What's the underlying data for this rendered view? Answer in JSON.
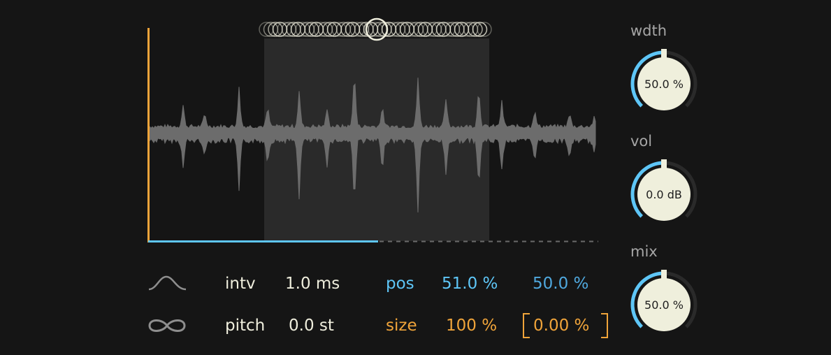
{
  "waveform": {
    "colors": {
      "background": "#151515",
      "selection": "#2a2a2a",
      "wave": "#6c6c6c",
      "envelope": "#f0a43a",
      "position": "#5ec6f7",
      "dashes": "#6a6a6a",
      "grain": "#efeedd"
    },
    "position_fraction": 0.51,
    "selection_fraction": [
      0.26,
      0.76
    ]
  },
  "params": {
    "intv": {
      "label": "intv",
      "value": "1.0 ms"
    },
    "pitch": {
      "label": "pitch",
      "value": "0.0 st"
    },
    "pos": {
      "label": "pos",
      "value": "51.0 %",
      "spread": "50.0 %"
    },
    "size": {
      "label": "size",
      "value": "100 %",
      "spread": "0.00 %"
    }
  },
  "icons": {
    "envelope": "envelope-curve-icon",
    "loop": "infinity-icon"
  },
  "knobs": [
    {
      "key": "wdth",
      "label": "wdth",
      "value": "50.0 %",
      "fraction": 0.5
    },
    {
      "key": "vol",
      "label": "vol",
      "value": "0.0 dB",
      "fraction": 0.5
    },
    {
      "key": "mix",
      "label": "mix",
      "value": "50.0 %",
      "fraction": 0.5
    }
  ]
}
